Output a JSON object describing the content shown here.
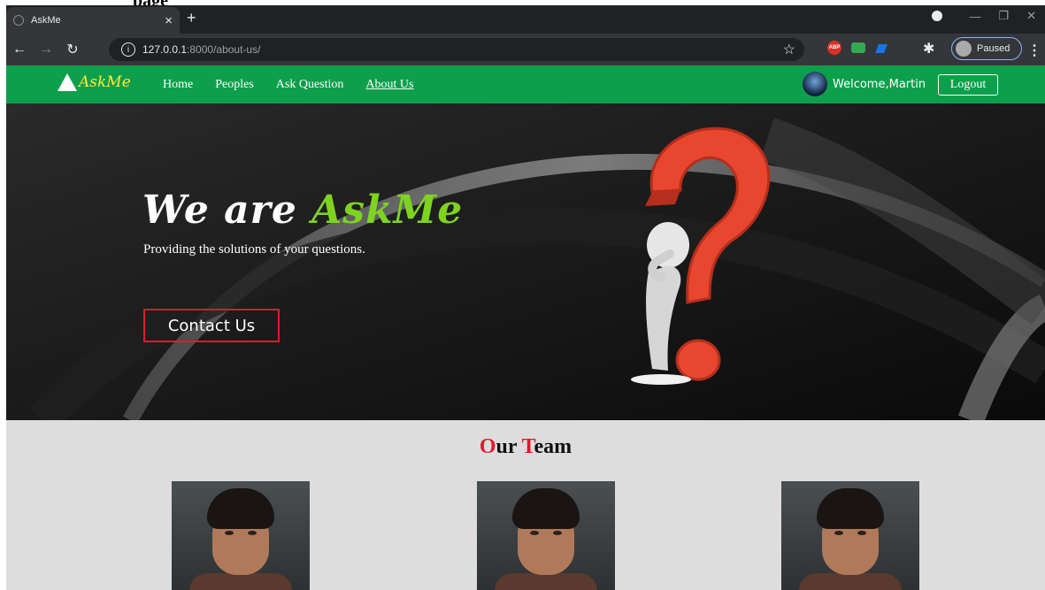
{
  "doc_fragment": "page",
  "browser": {
    "tab_title": "AskMe",
    "tab_close": "×",
    "new_tab": "+",
    "url_host": "127.0.0.1",
    "url_rest": ":8000/about-us/",
    "profile_status": "Paused",
    "abp_label": "ABP"
  },
  "nav": {
    "logo_text": "AskMe",
    "links": [
      "Home",
      "Peoples",
      "Ask Question",
      "About Us"
    ],
    "active_link": "About Us",
    "welcome": "Welcome,Martin",
    "logout": "Logout"
  },
  "hero": {
    "title_prefix": "We are ",
    "title_brand": "AskMe",
    "subtitle": "Providing the solutions of your questions.",
    "cta": "Contact Us"
  },
  "team": {
    "title_o": "O",
    "title_ur": "ur ",
    "title_t": "T",
    "title_eam": "eam",
    "member_count": 3
  },
  "colors": {
    "nav_green": "#0d9f4b",
    "brand_green": "#7ed321",
    "accent_red": "#e0192c",
    "logo_yellow": "#ffeb3b"
  },
  "icons": [
    "back-icon",
    "forward-icon",
    "reload-icon",
    "info-icon",
    "star-icon",
    "puzzle-icon",
    "menu-icon",
    "askme-logo-icon",
    "question-figure-icon"
  ]
}
